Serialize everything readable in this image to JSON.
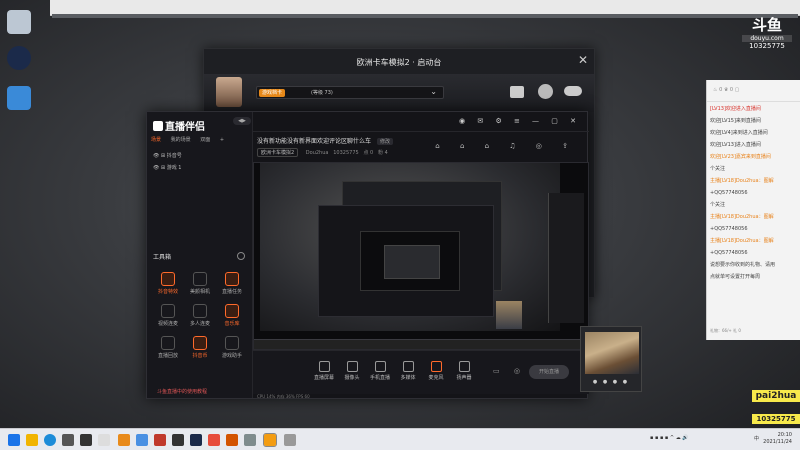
{
  "launcher": {
    "title": "欧洲卡车模拟2 · 启动台",
    "profile_badge": "游戏档卡",
    "profile_text": "(等级 73)"
  },
  "app": {
    "name": "直播伴侣",
    "scene_tabs": [
      "场景",
      "我的场景",
      "双面"
    ],
    "sources": [
      "抖音号",
      "游戏 1"
    ],
    "tools_title": "工具箱",
    "tools": [
      {
        "label": "抖音特效",
        "active": true
      },
      {
        "label": "美颜相机",
        "active": false
      },
      {
        "label": "直播任务",
        "active": false
      },
      {
        "label": "视频连麦",
        "active": false
      },
      {
        "label": "多人连麦",
        "active": false
      },
      {
        "label": "音乐库",
        "active": true
      },
      {
        "label": "直播回放",
        "active": false
      },
      {
        "label": "抖音币",
        "active": true
      },
      {
        "label": "游戏助手",
        "active": false
      }
    ],
    "footer_warning": "斗鱼直播中的使用教程",
    "stream_title": "没有新功能没有新界面欢迎评论区聊什么车",
    "title_tag": "修改",
    "category": "欧洲卡车模拟2",
    "user": "Dou2hua",
    "uid": "10325775",
    "stats": [
      "点 0",
      "粉 4"
    ],
    "bottom_tools": [
      "直播屏幕",
      "摄像头",
      "手机直播",
      "多媒体",
      "麦克风",
      "扬声器"
    ],
    "start_label": "开始直播",
    "status_text": "CPU 14%   内存 36%   FPS 60"
  },
  "chat": {
    "lines": [
      {
        "text": "[LV13]欢迎进入直播间",
        "color": "red"
      },
      {
        "text": "欢迎[LV15]来到直播间",
        "color": "gray"
      },
      {
        "text": "欢迎[LV4]来到进入直播间",
        "color": "gray"
      },
      {
        "text": "欢迎[LV13]进入直播间",
        "color": "gray"
      },
      {
        "text": "欢迎[LV23]嘉宾来到直播间",
        "color": "orange"
      },
      {
        "text": "个关注",
        "color": "gray"
      },
      {
        "text": "主播[LV18]Dou2hua：图解",
        "color": "orange"
      },
      {
        "text": "+QQ57748056",
        "color": "gray"
      },
      {
        "text": "个关注",
        "color": "gray"
      },
      {
        "text": "主播[LV18]Dou2hua：图解",
        "color": "orange"
      },
      {
        "text": "+QQ57748056",
        "color": "gray"
      },
      {
        "text": "主播[LV18]Dou2hua：图解",
        "color": "orange"
      },
      {
        "text": "+QQ57748056",
        "color": "gray"
      },
      {
        "text": "说想要示你收到的礼物、请用",
        "color": "gray"
      },
      {
        "text": "点就单可设置打开每周",
        "color": "gray"
      }
    ],
    "footer": "礼物：66/+ 礼 0"
  },
  "watermark": {
    "logo": "斗鱼",
    "sub": "douyu.com",
    "id": "10325775"
  },
  "overlay": {
    "name": "pai2hua",
    "id": "10325775"
  },
  "clock": {
    "time": "20:10",
    "date": "2021/11/24"
  },
  "tray_text": "中"
}
